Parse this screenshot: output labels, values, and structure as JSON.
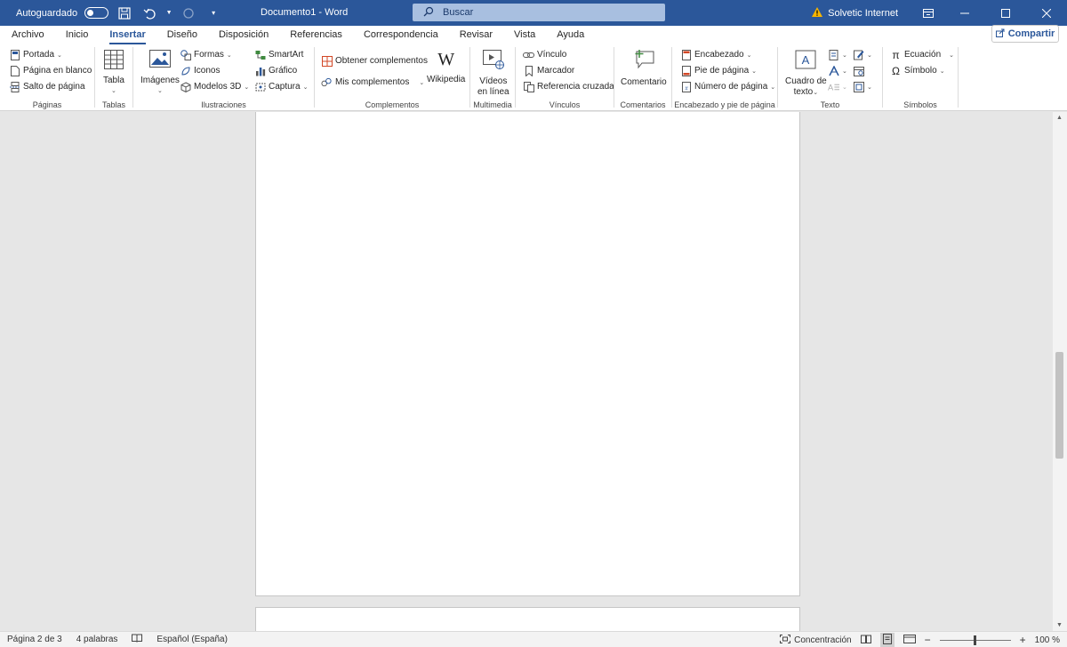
{
  "titlebar": {
    "autosave_label": "Autoguardado",
    "doc_title": "Documento1 - Word",
    "search_placeholder": "Buscar",
    "user_name": "Solvetic Internet"
  },
  "tabs": [
    "Archivo",
    "Inicio",
    "Insertar",
    "Diseño",
    "Disposición",
    "Referencias",
    "Correspondencia",
    "Revisar",
    "Vista",
    "Ayuda"
  ],
  "share_label": "Compartir",
  "ribbon": {
    "paginas": {
      "label": "Páginas",
      "items": [
        "Portada",
        "Página en blanco",
        "Salto de página"
      ]
    },
    "tablas": {
      "label": "Tablas",
      "tabla": "Tabla"
    },
    "ilustraciones": {
      "label": "Ilustraciones",
      "imagenes": "Imágenes",
      "formas": "Formas",
      "iconos": "Iconos",
      "modelos": "Modelos 3D",
      "smartart": "SmartArt",
      "grafico": "Gráfico",
      "captura": "Captura"
    },
    "complementos": {
      "label": "Complementos",
      "obtener": "Obtener complementos",
      "mis": "Mis complementos",
      "wikipedia": "Wikipedia"
    },
    "multimedia": {
      "label": "Multimedia",
      "videos_1": "Vídeos",
      "videos_2": "en línea"
    },
    "vinculos": {
      "label": "Vínculos",
      "vinculo": "Vínculo",
      "marcador": "Marcador",
      "referencia": "Referencia cruzada"
    },
    "comentarios": {
      "label": "Comentarios",
      "comentario": "Comentario"
    },
    "encabezado": {
      "label": "Encabezado y pie de página",
      "encabezado": "Encabezado",
      "pie": "Pie de página",
      "numero": "Número de página"
    },
    "texto": {
      "label": "Texto",
      "cuadro_1": "Cuadro de",
      "cuadro_2": "texto"
    },
    "simbolos": {
      "label": "Símbolos",
      "ecuacion": "Ecuación",
      "simbolo": "Símbolo"
    }
  },
  "status": {
    "page": "Página 2 de 3",
    "words": "4 palabras",
    "language": "Español (España)",
    "focus": "Concentración",
    "zoom": "100 %"
  }
}
